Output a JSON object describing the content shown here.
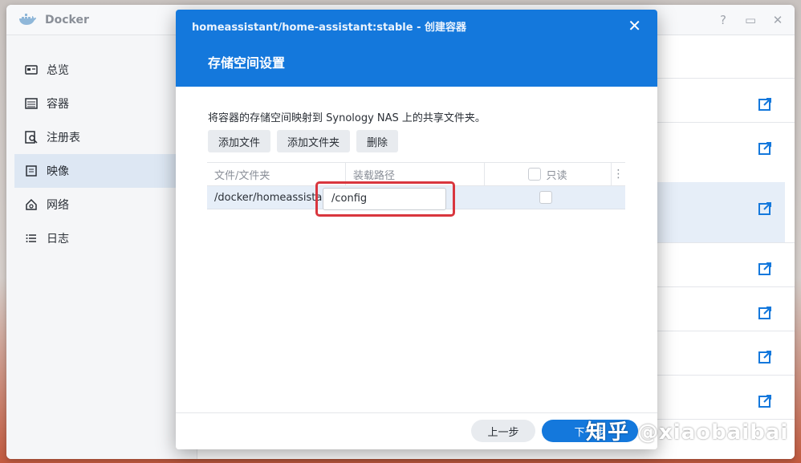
{
  "app": {
    "title": "Docker"
  },
  "window_controls": {
    "help": "?",
    "maximize": "▭",
    "close": "✕"
  },
  "sidebar": {
    "items": [
      {
        "label": "总览",
        "icon": "overview-icon"
      },
      {
        "label": "容器",
        "icon": "container-icon"
      },
      {
        "label": "注册表",
        "icon": "registry-icon"
      },
      {
        "label": "映像",
        "icon": "image-icon",
        "active": true
      },
      {
        "label": "网络",
        "icon": "network-icon"
      },
      {
        "label": "日志",
        "icon": "log-icon"
      }
    ]
  },
  "dialog": {
    "title": "homeassistant/home-assistant:stable - 创建容器",
    "subtitle": "存储空间设置",
    "description": "将容器的存储空间映射到 Synology NAS 上的共享文件夹。",
    "buttons": {
      "add_file": "添加文件",
      "add_folder": "添加文件夹",
      "delete": "删除"
    },
    "table": {
      "headers": {
        "file": "文件/文件夹",
        "mount_path": "装载路径",
        "readonly": "只读"
      },
      "rows": [
        {
          "file": "/docker/homeassistan...",
          "mount_path": "/config",
          "readonly": false
        }
      ]
    },
    "footer": {
      "prev": "上一步",
      "next": "下一步"
    }
  },
  "watermark": "知乎 @xiaobaibai",
  "colors": {
    "accent": "#1478dc",
    "highlight": "#d9363e",
    "row_selected": "#e6eef8"
  }
}
